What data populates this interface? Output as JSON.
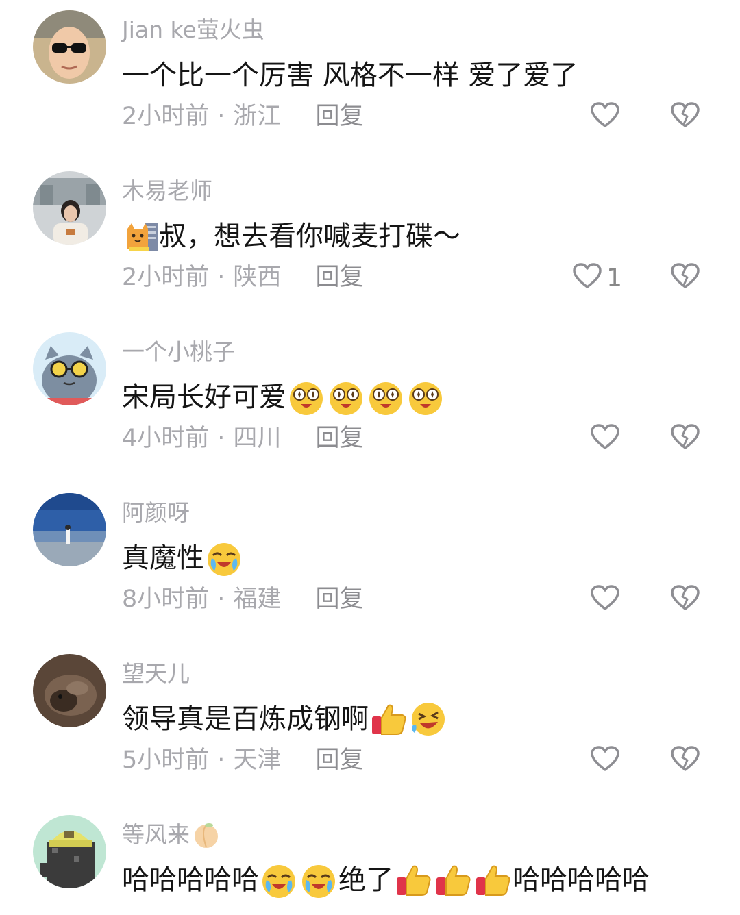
{
  "comments": [
    {
      "username": "Jian ke萤火虫",
      "text": "一个比一个厉害  风格不一样  爱了爱了",
      "time": "2小时前",
      "location": "浙江",
      "reply": "回复",
      "likes": ""
    },
    {
      "username": "木易老师",
      "text": "叔，想去看你喊麦打碟～",
      "time": "2小时前",
      "location": "陕西",
      "reply": "回复",
      "likes": "1"
    },
    {
      "username": "一个小桃子",
      "text": "宋局长好可爱",
      "time": "4小时前",
      "location": "四川",
      "reply": "回复",
      "likes": ""
    },
    {
      "username": "阿颜呀",
      "text": "真魔性",
      "time": "8小时前",
      "location": "福建",
      "reply": "回复",
      "likes": ""
    },
    {
      "username": "望天儿",
      "text": "领导真是百炼成钢啊",
      "time": "5小时前",
      "location": "天津",
      "reply": "回复",
      "likes": ""
    },
    {
      "username": "等风来",
      "text_part1": "哈哈哈哈哈",
      "text_part2": "绝了",
      "text_part3": "哈哈哈哈哈"
    }
  ],
  "separator": "·"
}
